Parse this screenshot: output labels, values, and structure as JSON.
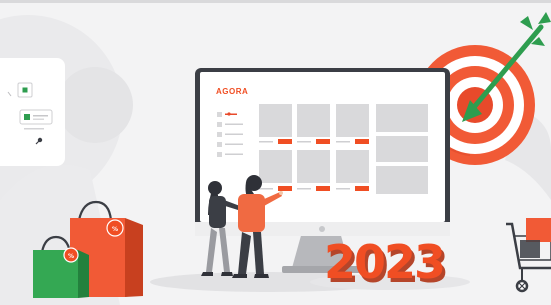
{
  "brand": {
    "logo_text": "AGORA"
  },
  "headline": {
    "year": "2023"
  },
  "bags": {
    "tag_symbol": "%"
  },
  "colors": {
    "accent": "#f04e23",
    "target_red": "#ee5233",
    "arrow_green": "#2e9d4f",
    "monitor_frame": "#3b3e45",
    "background": "#f3f3f4"
  }
}
